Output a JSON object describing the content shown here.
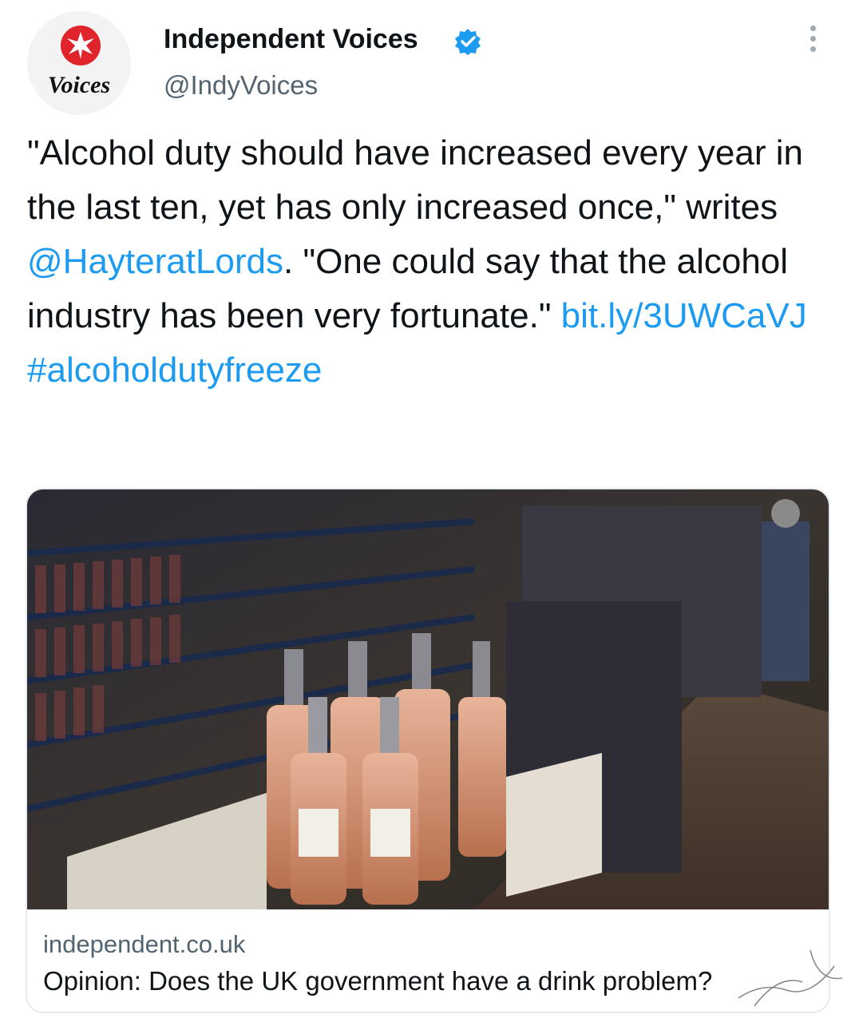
{
  "author": {
    "avatar_text": "Voices",
    "name": "Independent Voices",
    "handle": "@IndyVoices",
    "verified": true,
    "avatar_icon": "eagle-logo-icon",
    "brand_color": "#e0242b"
  },
  "more_icon": "more-options-icon",
  "tweet": {
    "text_part1": "\"Alcohol duty should have increased every year in the last ten, yet has only increased once,\" writes ",
    "mention": "@HayteratLords",
    "text_part2": ". \"One could say that the alcohol industry has been very fortunate.\" ",
    "url": "bit.ly/3UWCaVJ",
    "hashtag": "#alcoholdutyfreeze",
    "link_color": "#1d9bf0"
  },
  "card": {
    "domain": "independent.co.uk",
    "title": "Opinion: Does the UK government have a drink problem?",
    "image_description_icon": "wine-shelves-photo"
  },
  "watermark_icon": "calligraphy-watermark"
}
